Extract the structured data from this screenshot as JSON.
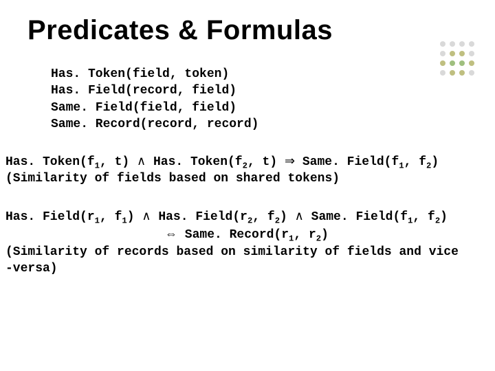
{
  "title": "Predicates & Formulas",
  "predicates": [
    "Has. Token(field, token)",
    "Has. Field(record, field)",
    "Same. Field(field, field)",
    "Same. Record(record, record)"
  ],
  "formula1": {
    "part_a": "Has. Token(f",
    "sub_a": "1",
    "part_b": ", t) ",
    "and": "∧",
    "part_c": " Has. Token(f",
    "sub_c": "2",
    "part_d": ", t) ",
    "implies": "⇒",
    "part_e": " Same. Field(f",
    "sub_e1": "1",
    "comma": ", f",
    "sub_e2": "2",
    "close": ")",
    "desc": "(Similarity of fields based on shared tokens)"
  },
  "formula2": {
    "p1": "Has. Field(r",
    "s1": "1",
    "p2": ", f",
    "s2": "1",
    "p3": ") ",
    "and1": "∧",
    "p4": " Has. Field(r",
    "s4": "2",
    "p5": ", f",
    "s5": "2",
    "p6": ") ",
    "and2": "∧",
    "p7": " Same. Field(f",
    "s7": "1",
    "p8": ", f",
    "s8": "2",
    "p9": ")",
    "iff": "⇔",
    "p10": " Same. Record(r",
    "s10": "1",
    "p11": ", r",
    "s11": "2",
    "p12": ")",
    "desc1": "(Similarity of records based on similarity of fields and  vice",
    "desc2": "-versa)"
  },
  "dot_colors": {
    "gray": "#d9d9d9",
    "olive": "#bfbf80",
    "green": "#9fbf7f"
  }
}
